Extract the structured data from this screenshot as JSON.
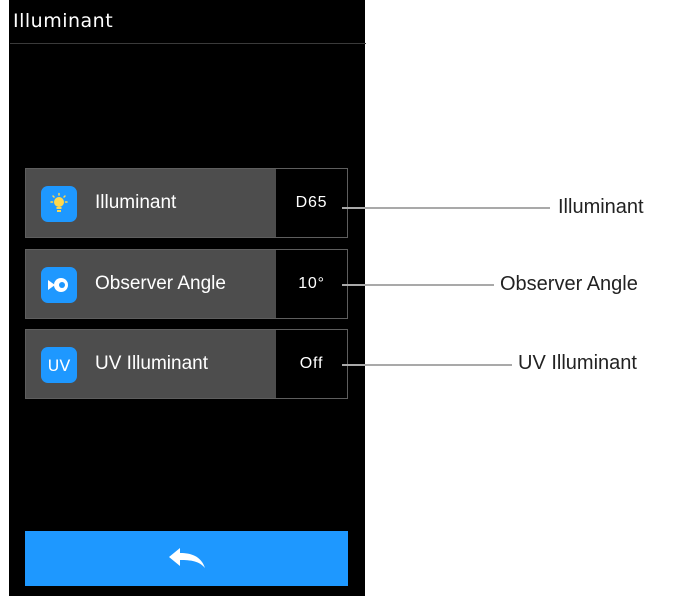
{
  "header": {
    "title": "Illuminant"
  },
  "settings": [
    {
      "icon": "lightbulb-icon",
      "label": "Illuminant",
      "value": "D65"
    },
    {
      "icon": "observer-eye-icon",
      "label": "Observer Angle",
      "value": "10°"
    },
    {
      "icon": "uv-icon",
      "label": "UV Illuminant",
      "value": "Off",
      "icon_text": "UV"
    }
  ],
  "footer": {
    "back_icon": "back-arrow-icon"
  },
  "callouts": [
    "Illuminant",
    "Observer Angle",
    "UV Illuminant"
  ],
  "colors": {
    "accent": "#1e98ff",
    "row_bg": "#4d4d4d",
    "screen_bg": "#000000",
    "callout_line": "#a9a9a9"
  }
}
